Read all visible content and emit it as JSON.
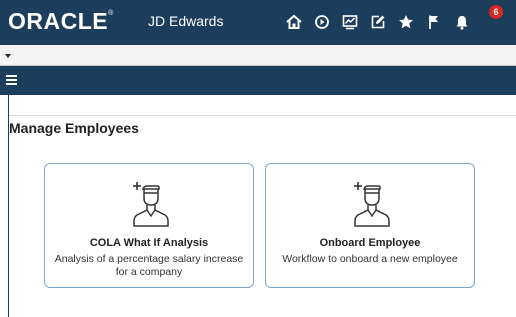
{
  "header": {
    "brand": "ORACLE",
    "brand_mark": "®",
    "product": "JD Edwards",
    "icons": [
      "home-icon",
      "recent-icon",
      "watchlists-icon",
      "edit-icon",
      "favorites-icon",
      "flag-icon",
      "notification-icon"
    ],
    "notification_count": "6",
    "colors": {
      "bar": "#1d3d5c",
      "badge": "#d6281f"
    }
  },
  "menubar": {
    "menu_icon": "hamburger-icon"
  },
  "page": {
    "title": "Manage Employees"
  },
  "tiles": [
    {
      "icon": "add-person-icon",
      "title": "COLA What If Analysis",
      "description": "Analysis of a percentage salary increase for a company"
    },
    {
      "icon": "add-person-icon",
      "title": "Onboard Employee",
      "description": "Workflow to onboard a new employee"
    }
  ]
}
